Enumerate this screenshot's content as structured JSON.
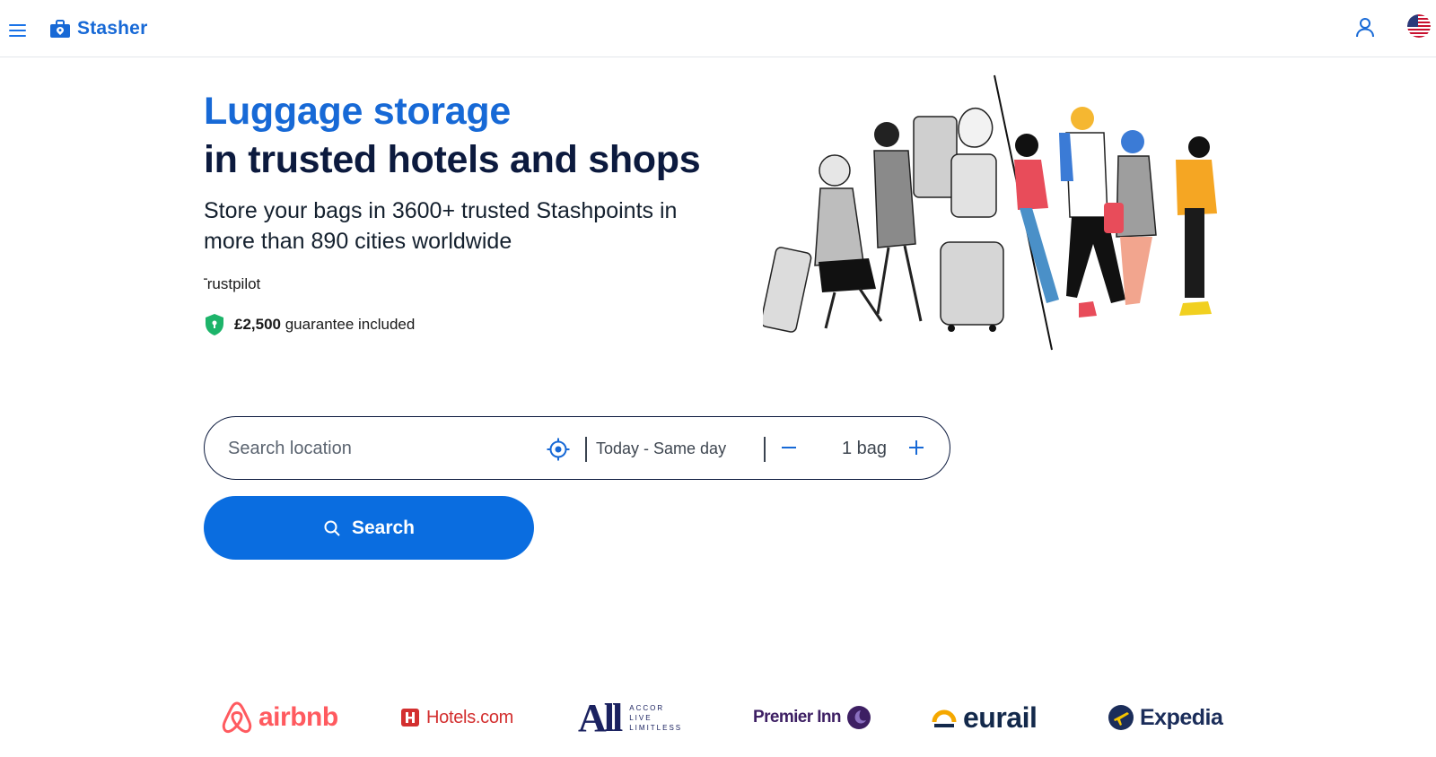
{
  "header": {
    "brand": "Stasher",
    "menu_icon": "hamburger-menu-icon",
    "account_icon": "user-icon",
    "language_icon": "us-flag-icon"
  },
  "hero": {
    "title_line1": "Luggage storage",
    "title_line2": "in trusted hotels and shops",
    "subtitle": "Store your bags in 3600+ trusted Stashpoints in more than 890 cities worldwide",
    "trustpilot": "Trustpilot",
    "guarantee_amount": "£2,500",
    "guarantee_text": " guarantee included"
  },
  "search": {
    "location_placeholder": "Search location",
    "date_value": "Today - Same day",
    "bag_count": "1 bag",
    "button_label": "Search"
  },
  "partners": [
    {
      "name": "airbnb"
    },
    {
      "name": "Hotels.com"
    },
    {
      "name": "All",
      "tagline": [
        "ACCOR",
        "LIVE",
        "LIMITLESS"
      ]
    },
    {
      "name": "Premier Inn"
    },
    {
      "name": "eurail"
    },
    {
      "name": "Expedia"
    }
  ],
  "colors": {
    "brand_blue": "#1769d6",
    "button_blue": "#0a6de0",
    "navy": "#0c1a3e",
    "shield_green": "#1db46a"
  }
}
